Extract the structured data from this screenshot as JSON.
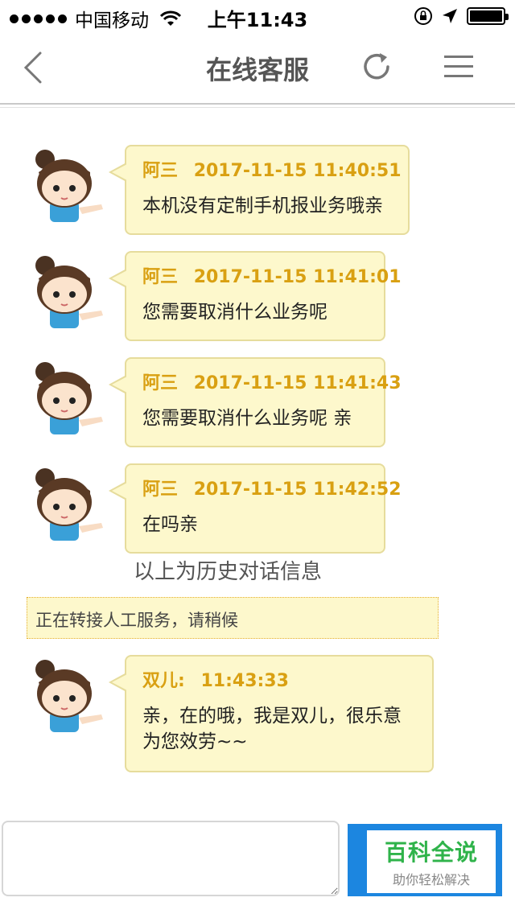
{
  "status_bar": {
    "carrier": "中国移动",
    "time": "上午11:43"
  },
  "nav": {
    "title": "在线客服",
    "icons": [
      "back-chevron-icon",
      "refresh-icon",
      "menu-icon"
    ]
  },
  "messages": [
    {
      "sender": "阿三",
      "timestamp": "2017-11-15 11:40:51",
      "text": "本机没有定制手机报业务哦亲"
    },
    {
      "sender": "阿三",
      "timestamp": "2017-11-15 11:41:01",
      "text": "您需要取消什么业务呢"
    },
    {
      "sender": "阿三",
      "timestamp": "2017-11-15 11:41:43",
      "text": "您需要取消什么业务呢 亲"
    },
    {
      "sender": "阿三",
      "timestamp": "2017-11-15 11:42:52",
      "text": "在吗亲"
    },
    {
      "sender": "双儿:",
      "timestamp": "11:43:33",
      "text_lines": [
        "亲，在的哦，我是双儿，很乐意",
        "为您效劳~~"
      ]
    }
  ],
  "history_note": "以上为历史对话信息",
  "transfer_note": "正在转接人工服务，请稍候",
  "input": {
    "value": ""
  },
  "watermark": {
    "title": "百科全说",
    "subtitle": "助你轻松解决"
  },
  "colors": {
    "bubble_bg": "#fdf8cc",
    "bubble_border": "#e6dc9c",
    "header_text": "#d9a012",
    "send_button": "#1c86e0",
    "watermark_green": "#2fb34a"
  }
}
